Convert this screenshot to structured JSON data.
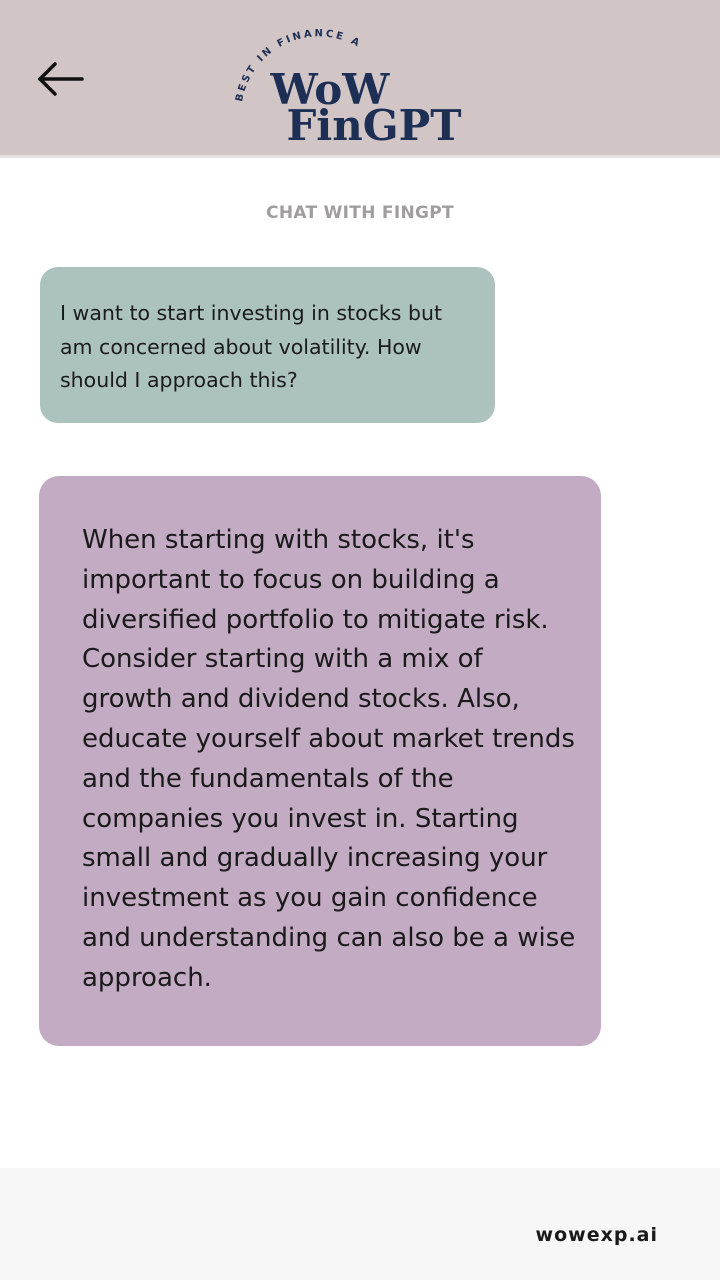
{
  "header": {
    "back_icon": "arrow-left-icon",
    "logo": {
      "arc_text": "BEST IN FINANCE ADVISORY",
      "line1": "WoW",
      "line2": "FinGPT",
      "color": "#1e2f55"
    },
    "background": "#d1c5c6"
  },
  "chat": {
    "title": "CHAT WITH FINGPT",
    "messages": [
      {
        "role": "user",
        "text": "I want to start investing in stocks but am concerned about volatility. How should I approach this?",
        "color": "#abc2bf"
      },
      {
        "role": "assistant",
        "text": "When starting with stocks, it's important to focus on building a diversified portfolio to mitigate risk. Consider starting with a mix of growth and dividend stocks. Also, educate yourself about market trends and the fundamentals of the companies you invest in. Starting small and gradually increasing your investment as you gain confidence and understanding can also be a wise approach.",
        "color": "#c2abc3"
      }
    ]
  },
  "footer": {
    "brand": "wowexp.ai"
  }
}
